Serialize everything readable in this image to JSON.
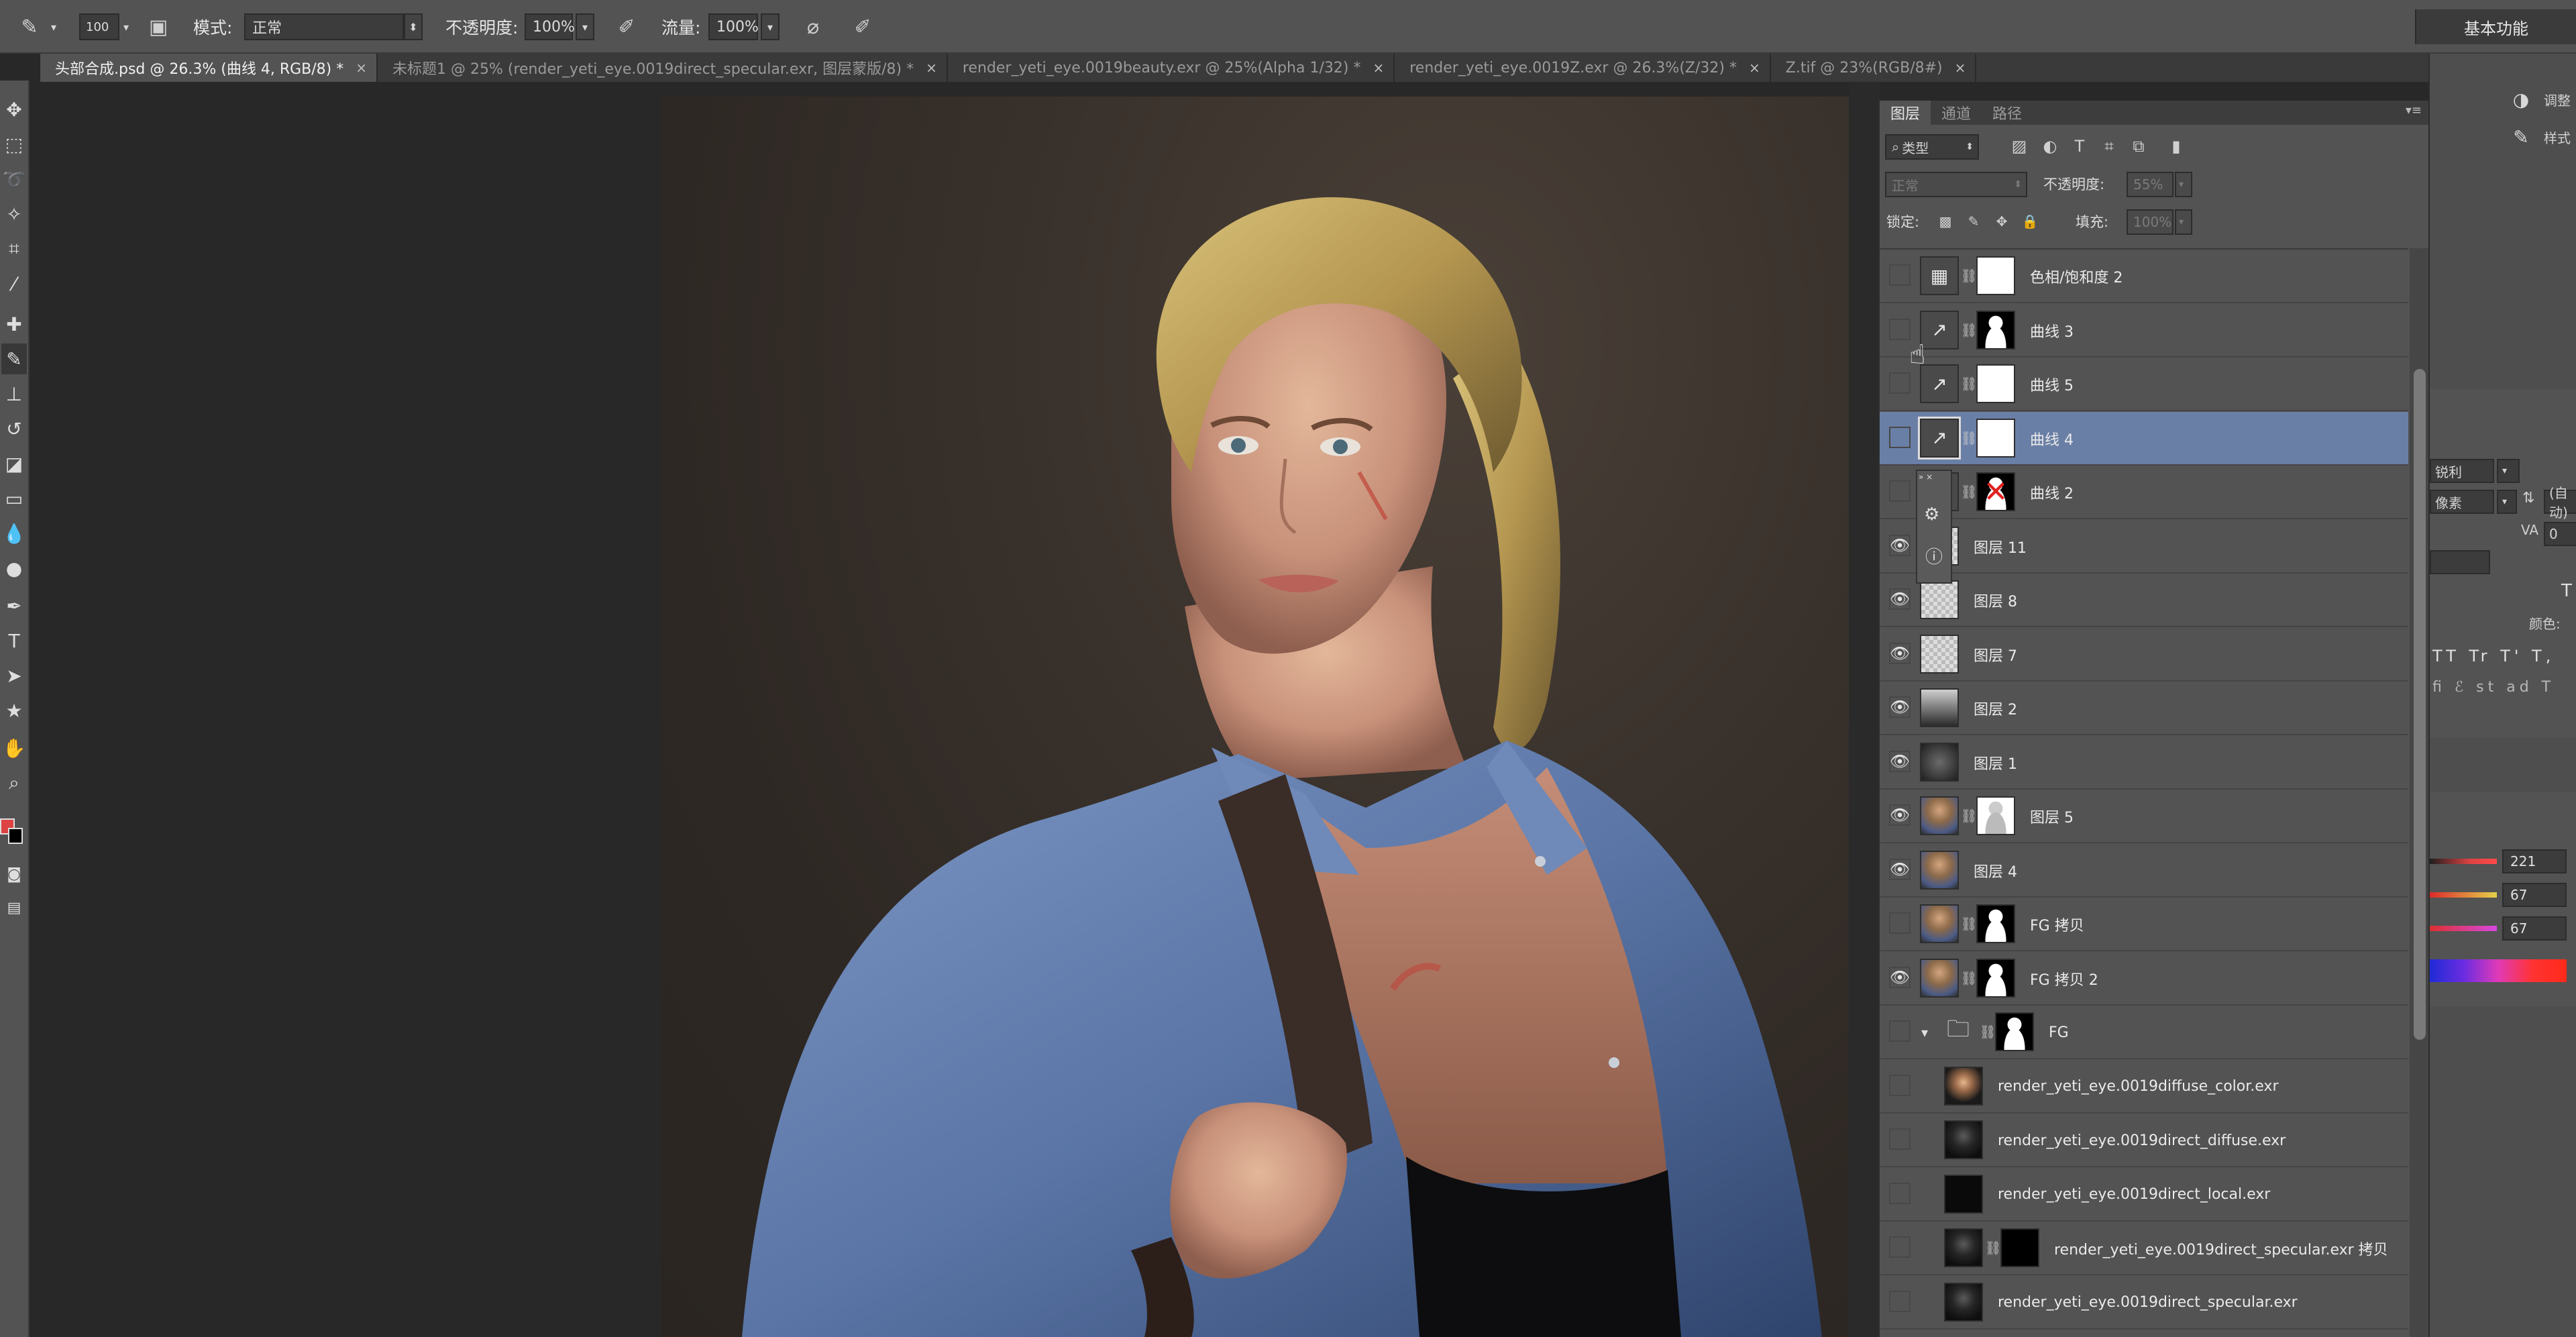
{
  "options_bar": {
    "brush_size": "100",
    "mode_label": "模式:",
    "mode_value": "正常",
    "opacity_label": "不透明度:",
    "opacity_value": "100%",
    "flow_label": "流量:",
    "flow_value": "100%",
    "workspace": "基本功能"
  },
  "tabs": [
    {
      "label": "头部合成.psd @ 26.3% (曲线 4, RGB/8) *",
      "active": true
    },
    {
      "label": "未标题1 @ 25% (render_yeti_eye.0019direct_specular.exr, 图层蒙版/8) *",
      "active": false
    },
    {
      "label": "render_yeti_eye.0019beauty.exr @ 25%(Alpha 1/32) *",
      "active": false
    },
    {
      "label": "render_yeti_eye.0019Z.exr @ 26.3%(Z/32) *",
      "active": false
    },
    {
      "label": "Z.tif @ 23%(RGB/8#)",
      "active": false
    }
  ],
  "layers_panel": {
    "tabs": [
      "图层",
      "通道",
      "路径"
    ],
    "filter_label": "类型",
    "blend_mode": "正常",
    "opacity_label": "不透明度:",
    "opacity_value": "55%",
    "lock_label": "锁定:",
    "fill_label": "填充:",
    "fill_value": "100%",
    "layers": [
      {
        "name": "色相/饱和度 2",
        "visible": false,
        "thumb": "adjust-hue",
        "mask": "white",
        "selected": false
      },
      {
        "name": "曲线 3",
        "visible": false,
        "thumb": "adjust-curves",
        "mask": "figure",
        "selected": false
      },
      {
        "name": "曲线 5",
        "visible": false,
        "thumb": "adjust-curves",
        "mask": "white",
        "selected": false
      },
      {
        "name": "曲线 4",
        "visible": false,
        "thumb": "adjust-curves",
        "mask": "white",
        "selected": true
      },
      {
        "name": "曲线 2",
        "visible": false,
        "thumb": "adjust-curves",
        "mask": "figure-red-x",
        "selected": false
      },
      {
        "name": "图层 11",
        "visible": true,
        "thumb": "transparent",
        "mask": "",
        "selected": false
      },
      {
        "name": "图层 8",
        "visible": true,
        "thumb": "transparent",
        "mask": "",
        "selected": false
      },
      {
        "name": "图层 7",
        "visible": true,
        "thumb": "transparent",
        "mask": "",
        "selected": false
      },
      {
        "name": "图层 2",
        "visible": true,
        "thumb": "gradient",
        "mask": "",
        "selected": false
      },
      {
        "name": "图层 1",
        "visible": true,
        "thumb": "dark-radial",
        "mask": "",
        "selected": false
      },
      {
        "name": "图层 5",
        "visible": true,
        "thumb": "portrait",
        "mask": "figure-light",
        "selected": false
      },
      {
        "name": "图层 4",
        "visible": true,
        "thumb": "portrait",
        "mask": "",
        "selected": false
      },
      {
        "name": "FG 拷贝",
        "visible": false,
        "thumb": "portrait",
        "mask": "figure",
        "selected": false
      },
      {
        "name": "FG 拷贝 2",
        "visible": true,
        "thumb": "portrait",
        "mask": "figure",
        "selected": false
      },
      {
        "name": "FG",
        "visible": false,
        "thumb": "folder",
        "mask": "figure",
        "selected": false,
        "group": true
      },
      {
        "name": "render_yeti_eye.0019diffuse_color.exr",
        "visible": false,
        "thumb": "render-color",
        "mask": "",
        "selected": false,
        "indent": true
      },
      {
        "name": "render_yeti_eye.0019direct_diffuse.exr",
        "visible": false,
        "thumb": "render-dark",
        "mask": "",
        "selected": false,
        "indent": true
      },
      {
        "name": "render_yeti_eye.0019direct_local.exr",
        "visible": false,
        "thumb": "render-black",
        "mask": "",
        "selected": false,
        "indent": true
      },
      {
        "name": "render_yeti_eye.0019direct_specular.exr 拷贝",
        "visible": false,
        "thumb": "render-dark",
        "mask": "black",
        "selected": false,
        "indent": true
      },
      {
        "name": "render_yeti_eye.0019direct_specular.exr",
        "visible": false,
        "thumb": "render-dark",
        "mask": "",
        "selected": false,
        "indent": true
      }
    ]
  },
  "right_dock": {
    "adjust_label": "调整",
    "style_label": "样式",
    "char_panel": {
      "aa_value": "锐利",
      "units_value": "像素",
      "auto_value": "(自动)",
      "tracking_value": "0",
      "color_label": "颜色:"
    },
    "color_panel": {
      "r": "221",
      "g": "67",
      "b": "67"
    }
  },
  "colors": {
    "accent_selected": "#6a7fa6",
    "foreground": "#dd4343",
    "background": "#000000"
  }
}
